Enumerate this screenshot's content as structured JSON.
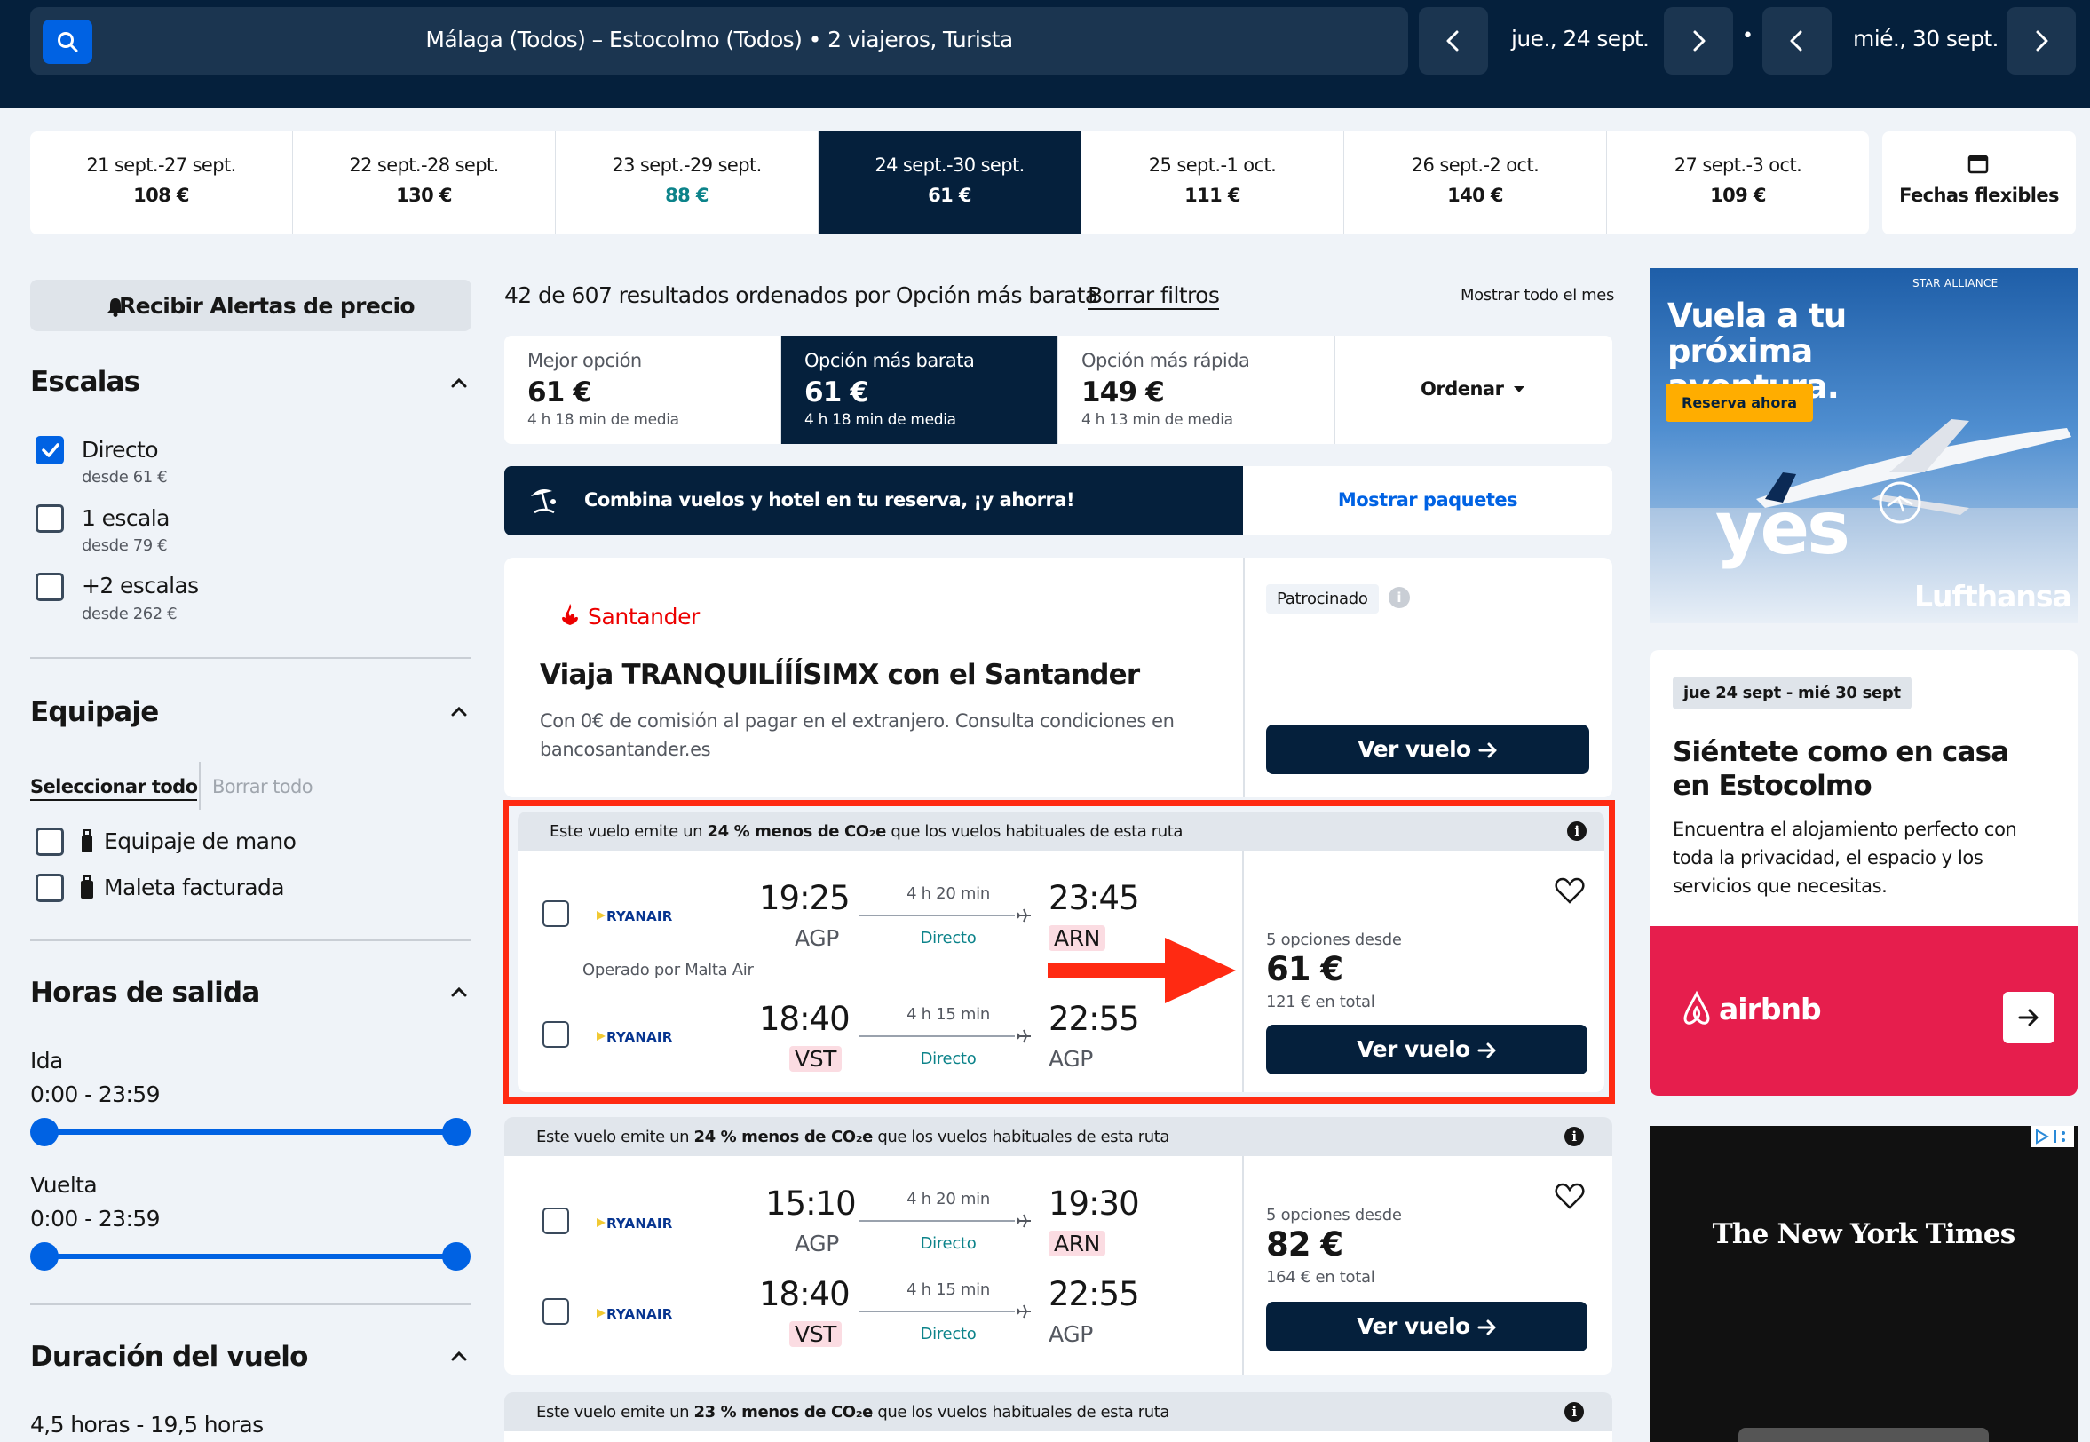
{
  "search": {
    "summary": "Málaga (Todos) – Estocolmo (Todos)  •  2 viajeros, Turista",
    "depart_date": "jue., 24 sept.",
    "return_date": "mié., 30 sept.",
    "separator": "•"
  },
  "date_strip": [
    {
      "range": "21 sept.-27 sept.",
      "price": "108 €"
    },
    {
      "range": "22 sept.-28 sept.",
      "price": "130 €"
    },
    {
      "range": "23 sept.-29 sept.",
      "price": "88 €"
    },
    {
      "range": "24 sept.-30 sept.",
      "price": "61 €"
    },
    {
      "range": "25 sept.-1 oct.",
      "price": "111 €"
    },
    {
      "range": "26 sept.-2 oct.",
      "price": "140 €"
    },
    {
      "range": "27 sept.-3 oct.",
      "price": "109 €"
    }
  ],
  "flexible_dates": "Fechas flexibles",
  "sidebar": {
    "alerts": "Recibir Alertas de precio",
    "stops_title": "Escalas",
    "stops": [
      {
        "label": "Directo",
        "sub": "desde 61 €",
        "checked": true
      },
      {
        "label": "1 escala",
        "sub": "desde 79 €",
        "checked": false
      },
      {
        "label": "+2 escalas",
        "sub": "desde 262 €",
        "checked": false
      }
    ],
    "baggage_title": "Equipaje",
    "select_all": "Seleccionar todo",
    "clear_all": "Borrar todo",
    "baggage": [
      "Equipaje de mano",
      "Maleta facturada"
    ],
    "departure_title": "Horas de salida",
    "outbound_label": "Ida",
    "outbound_range": "0:00 - 23:59",
    "return_label": "Vuelta",
    "return_range": "0:00 - 23:59",
    "duration_title": "Duración del vuelo",
    "duration_range": "4,5 horas - 19,5 horas"
  },
  "results": {
    "summary": "42 de 607 resultados ordenados por Opción más barata",
    "clear_filters": "Borrar filtros",
    "show_month": "Mostrar todo el mes",
    "sort_tabs": [
      {
        "label": "Mejor opción",
        "price": "61 €",
        "avg": "4 h 18 min de media"
      },
      {
        "label": "Opción más barata",
        "price": "61 €",
        "avg": "4 h 18 min de media"
      },
      {
        "label": "Opción más rápida",
        "price": "149 €",
        "avg": "4 h 13 min de media"
      }
    ],
    "sort_button": "Ordenar",
    "combo_text": "Combina vuelos y hotel en tu reserva, ¡y ahorra!",
    "combo_link": "Mostrar paquetes"
  },
  "sponsored": {
    "brand": "Santander",
    "title": "Viaja TRANQUILÍÍÍSIMX con el Santander",
    "body": "Con 0€ de comisión al pagar en el extranjero. Consulta condiciones en bancosantander.es",
    "badge": "Patrocinado",
    "button": "Ver vuelo"
  },
  "flights": [
    {
      "co2_pre": "Este vuelo emite un ",
      "co2_bold": "24 % menos de CO₂e",
      "co2_post": " que los vuelos habituales de esta ruta",
      "out": {
        "airline": "RYANAIR",
        "dep": "19:25",
        "from": "AGP",
        "dur": "4 h 20 min",
        "type": "Directo",
        "arr": "23:45",
        "to": "ARN"
      },
      "operated": "Operado por Malta Air",
      "ret": {
        "airline": "RYANAIR",
        "dep": "18:40",
        "from": "VST",
        "dur": "4 h 15 min",
        "type": "Directo",
        "arr": "22:55",
        "to": "AGP"
      },
      "options": "5 opciones desde",
      "price": "61 €",
      "total": "121 € en total",
      "button": "Ver vuelo"
    },
    {
      "co2_pre": "Este vuelo emite un ",
      "co2_bold": "24 % menos de CO₂e",
      "co2_post": " que los vuelos habituales de esta ruta",
      "out": {
        "airline": "RYANAIR",
        "dep": "15:10",
        "from": "AGP",
        "dur": "4 h 20 min",
        "type": "Directo",
        "arr": "19:30",
        "to": "ARN"
      },
      "ret": {
        "airline": "RYANAIR",
        "dep": "18:40",
        "from": "VST",
        "dur": "4 h 15 min",
        "type": "Directo",
        "arr": "22:55",
        "to": "AGP"
      },
      "options": "5 opciones desde",
      "price": "82 €",
      "total": "164 € en total",
      "button": "Ver vuelo"
    },
    {
      "co2_pre": "Este vuelo emite un ",
      "co2_bold": "23 % menos de CO₂e",
      "co2_post": " que los vuelos habituales de esta ruta"
    }
  ],
  "ads": {
    "lufthansa": {
      "alliance": "STAR ALLIANCE",
      "headline": "Vuela a tu próxima aventura.",
      "cta": "Reserva ahora",
      "slogan": "yes",
      "brand": "Lufthansa"
    },
    "airbnb": {
      "dates": "jue 24 sept - mié 30 sept",
      "title": "Siéntete como en casa en Estocolmo",
      "body": "Encuentra el alojamiento perfecto con toda la privacidad, el espacio y los servicios que necesitas.",
      "brand": "airbnb"
    },
    "nyt": {
      "brand": "The New York Times"
    }
  },
  "colors": {
    "navy": "#05203c",
    "blue": "#0062e3",
    "teal": "#0c838a",
    "highlight_red": "#ff2a12",
    "airbnb": "#e61e4d"
  }
}
